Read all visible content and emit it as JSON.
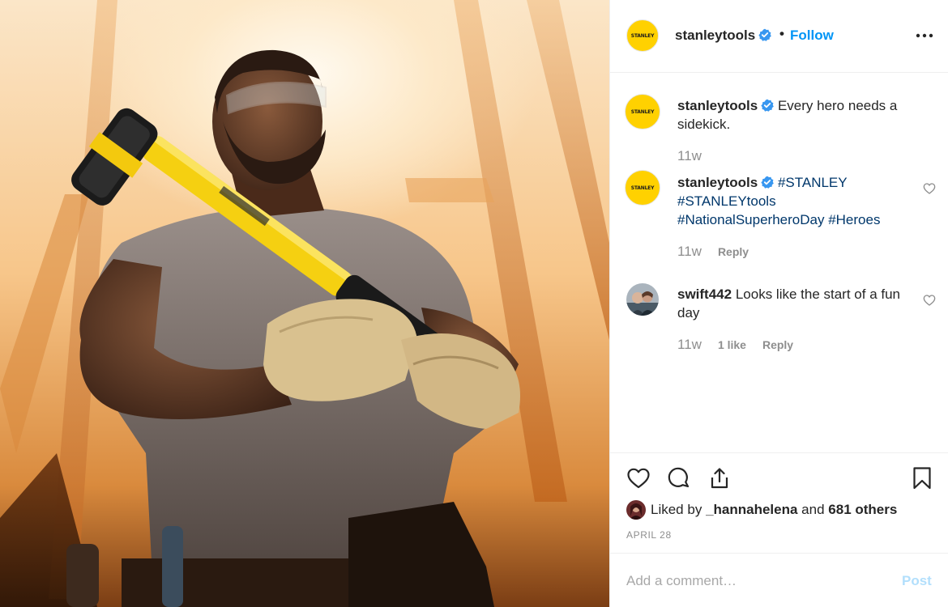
{
  "post": {
    "photo_description": "",
    "author": {
      "username": "stanleytools",
      "avatar_text": "STANLEY",
      "verified": true,
      "follow_label": "Follow",
      "separator": "•"
    },
    "caption": {
      "username": "stanleytools",
      "text": "Every hero needs a sidekick.",
      "time": "11w"
    },
    "comments": [
      {
        "username": "stanleytools",
        "hashtags": [
          "#STANLEY",
          "#STANLEYtools",
          "#NationalSuperheroDay",
          "#Heroes"
        ],
        "time": "11w",
        "reply_label": "Reply"
      },
      {
        "username": "swift442",
        "text": "Looks like the start of a fun day",
        "time": "11w",
        "likes_label": "1 like",
        "reply_label": "Reply"
      }
    ],
    "likes": {
      "prefix": "Liked by",
      "first_user": "_hannahelena",
      "middle": "and",
      "others": "681 others"
    },
    "date": "APRIL 28",
    "comment_box": {
      "placeholder": "Add a comment…",
      "post_label": "Post"
    },
    "icons": {
      "verified": "verified-badge-icon",
      "more": "more-options-icon",
      "like": "heart-icon",
      "comment": "comment-bubble-icon",
      "share": "share-icon",
      "save": "bookmark-icon"
    },
    "colors": {
      "link_blue": "#0095f6",
      "hashtag": "#00376b",
      "muted": "#8e8e8e",
      "brand_yellow": "#ffd100",
      "post_disabled": "#b2dffc"
    }
  }
}
